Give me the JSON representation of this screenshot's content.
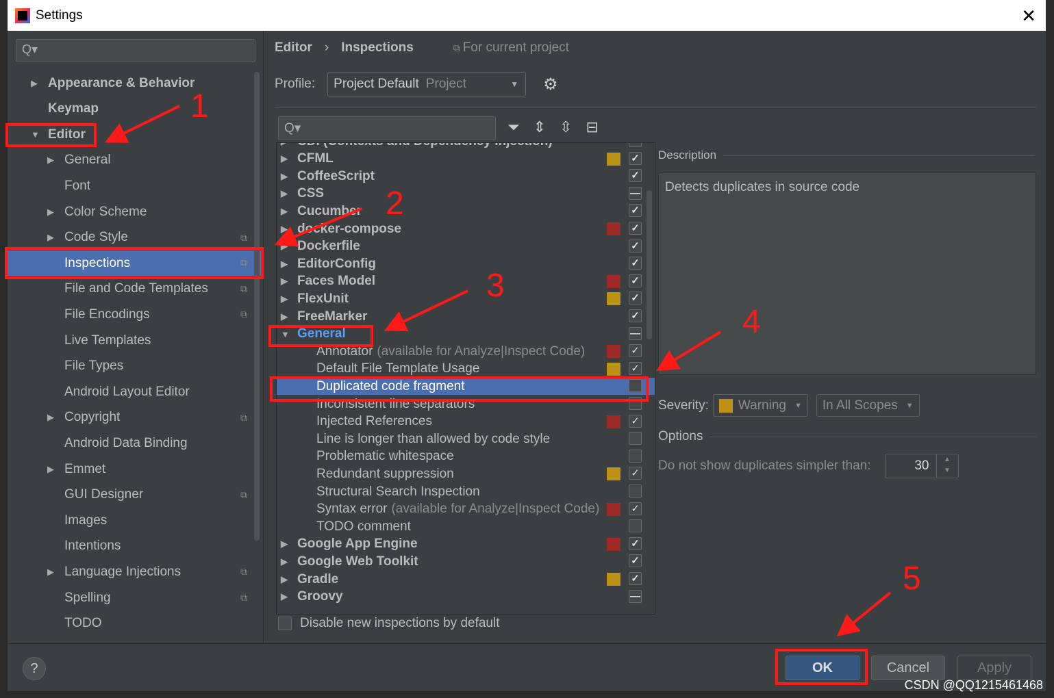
{
  "window": {
    "title": "Settings",
    "close_icon": "close-icon"
  },
  "sidebar": {
    "search_placeholder": "Q▾",
    "items": [
      {
        "label": "Appearance & Behavior",
        "level": 0,
        "arrow": "collapsed",
        "bold": true
      },
      {
        "label": "Keymap",
        "level": 0,
        "bold": true
      },
      {
        "label": "Editor",
        "level": 0,
        "arrow": "expanded",
        "bold": true
      },
      {
        "label": "General",
        "level": 1,
        "arrow": "collapsed"
      },
      {
        "label": "Font",
        "level": 1
      },
      {
        "label": "Color Scheme",
        "level": 1,
        "arrow": "collapsed"
      },
      {
        "label": "Code Style",
        "level": 1,
        "arrow": "collapsed",
        "project": true
      },
      {
        "label": "Inspections",
        "level": 1,
        "project": true,
        "selected": true
      },
      {
        "label": "File and Code Templates",
        "level": 1,
        "project": true
      },
      {
        "label": "File Encodings",
        "level": 1,
        "project": true
      },
      {
        "label": "Live Templates",
        "level": 1
      },
      {
        "label": "File Types",
        "level": 1
      },
      {
        "label": "Android Layout Editor",
        "level": 1
      },
      {
        "label": "Copyright",
        "level": 1,
        "arrow": "collapsed",
        "project": true
      },
      {
        "label": "Android Data Binding",
        "level": 1
      },
      {
        "label": "Emmet",
        "level": 1,
        "arrow": "collapsed"
      },
      {
        "label": "GUI Designer",
        "level": 1,
        "project": true
      },
      {
        "label": "Images",
        "level": 1
      },
      {
        "label": "Intentions",
        "level": 1
      },
      {
        "label": "Language Injections",
        "level": 1,
        "arrow": "collapsed",
        "project": true
      },
      {
        "label": "Spelling",
        "level": 1,
        "project": true
      },
      {
        "label": "TODO",
        "level": 1
      }
    ]
  },
  "main": {
    "breadcrumb": [
      "Editor",
      "Inspections"
    ],
    "scope_note": "For current project",
    "profile_label": "Profile:",
    "profile_value": "Project Default",
    "profile_sub": "Project",
    "tree_search_placeholder": "Q▾",
    "colors": {
      "warning": "#be9117",
      "error": "#9e2927",
      "selected": "#4b6eaf"
    },
    "tree": [
      {
        "label": "CDI (Contexts and Dependency Injection)",
        "group": true,
        "check": "checked"
      },
      {
        "label": "CFML",
        "group": true,
        "sev": "warning",
        "check": "checked"
      },
      {
        "label": "CoffeeScript",
        "group": true,
        "check": "checked"
      },
      {
        "label": "CSS",
        "group": true,
        "check": "partial"
      },
      {
        "label": "Cucumber",
        "group": true,
        "check": "checked"
      },
      {
        "label": "docker-compose",
        "group": true,
        "sev": "error",
        "check": "checked"
      },
      {
        "label": "Dockerfile",
        "group": true,
        "check": "checked"
      },
      {
        "label": "EditorConfig",
        "group": true,
        "check": "checked"
      },
      {
        "label": "Faces Model",
        "group": true,
        "sev": "error",
        "check": "checked"
      },
      {
        "label": "FlexUnit",
        "group": true,
        "sev": "warning",
        "check": "checked"
      },
      {
        "label": "FreeMarker",
        "group": true,
        "check": "checked"
      },
      {
        "label": "General",
        "group": true,
        "expanded": true,
        "check": "partial",
        "highlight": true
      },
      {
        "label": "Annotator",
        "note": "(available for Analyze|Inspect Code)",
        "sev": "error",
        "check": "checked"
      },
      {
        "label": "Default File Template Usage",
        "sev": "warning",
        "check": "checked"
      },
      {
        "label": "Duplicated code fragment",
        "selected": true,
        "check": "unchecked"
      },
      {
        "label": "Inconsistent line separators",
        "check": "unchecked"
      },
      {
        "label": "Injected References",
        "sev": "error",
        "check": "checked"
      },
      {
        "label": "Line is longer than allowed by code style",
        "check": "unchecked"
      },
      {
        "label": "Problematic whitespace",
        "check": "unchecked"
      },
      {
        "label": "Redundant suppression",
        "sev": "warning",
        "check": "checked"
      },
      {
        "label": "Structural Search Inspection",
        "check": "unchecked"
      },
      {
        "label": "Syntax error",
        "note": "(available for Analyze|Inspect Code)",
        "sev": "error",
        "check": "checked"
      },
      {
        "label": "TODO comment",
        "check": "unchecked"
      },
      {
        "label": "Google App Engine",
        "group": true,
        "sev": "error",
        "check": "checked"
      },
      {
        "label": "Google Web Toolkit",
        "group": true,
        "check": "checked"
      },
      {
        "label": "Gradle",
        "group": true,
        "sev": "warning",
        "check": "checked"
      },
      {
        "label": "Groovy",
        "group": true,
        "check": "partial"
      }
    ],
    "disable_new": "Disable new inspections by default",
    "description_label": "Description",
    "description": "Detects duplicates in source code",
    "severity_label": "Severity:",
    "severity_value": "Warning",
    "scope_value": "In All Scopes",
    "options_label": "Options",
    "dup_label": "Do not show duplicates simpler than:",
    "dup_value": "30"
  },
  "footer": {
    "help": "?",
    "ok": "OK",
    "cancel": "Cancel",
    "apply": "Apply",
    "watermark": "CSDN @QQ1215461468"
  },
  "annotations": [
    "1",
    "2",
    "3",
    "4",
    "5"
  ]
}
